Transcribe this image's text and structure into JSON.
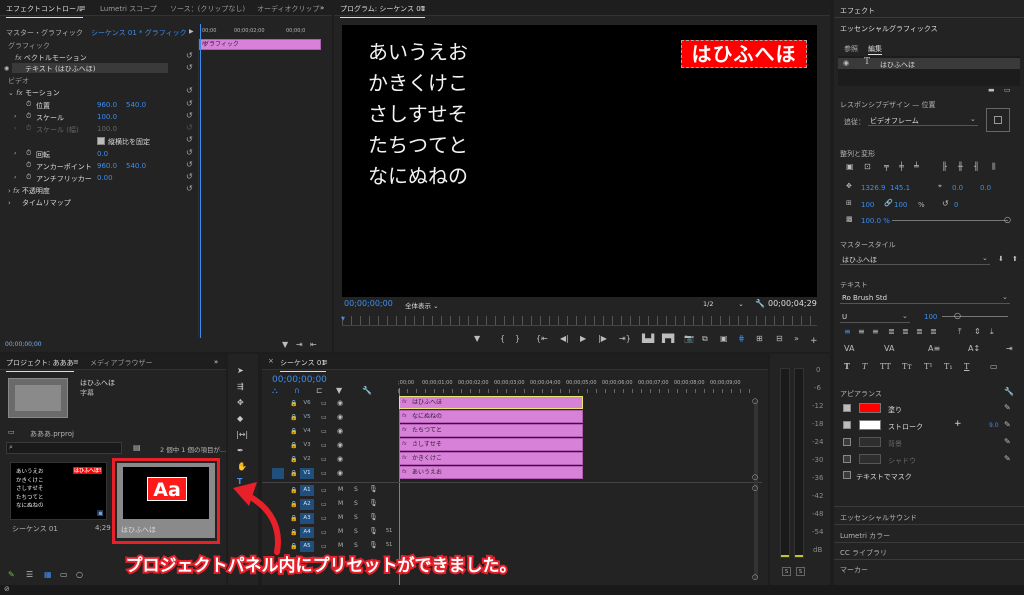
{
  "effect_controls": {
    "tab_label": "エフェクトコントロール",
    "tab_menu": "≡",
    "tab_lumetri": "Lumetri スコープ",
    "tab_source": "ソース：(クリップなし)",
    "tab_audio": "オーディオクリップ",
    "overflow": "»",
    "master": "マスター・グラフィック",
    "sequence": "シーケンス 01 * グラフィック",
    "ruler": [
      "00;00",
      "00;00;02;00",
      "00;00;0"
    ],
    "clip_label": "グラフィック",
    "section_graphic": "グラフィック",
    "vector_motion": "ベクトルモーション",
    "text_layer": "テキスト (はひふへほ)",
    "section_video": "ビデオ",
    "motion": "モーション",
    "position_label": "位置",
    "position_x": "960.0",
    "position_y": "540.0",
    "scale_label": "スケール",
    "scale_value": "100.0",
    "scale_w_label": "スケール (幅)",
    "scale_w_value": "100.0",
    "uniform_scale": "縦横比を固定",
    "rotation_label": "回転",
    "rotation_value": "0.0",
    "anchor_label": "アンカーポイント",
    "anchor_x": "960.0",
    "anchor_y": "540.0",
    "flicker_label": "アンチフリッカー",
    "flicker_value": "0.00",
    "opacity": "不透明度",
    "time_remap": "タイムリマップ",
    "timecode": "00;00;00;00"
  },
  "program": {
    "tab_label": "プログラム: シーケンス 01",
    "tab_menu": "≡",
    "lines": [
      "あいうえお",
      "かきくけこ",
      "さしすせそ",
      "たちつてと",
      "なにぬねの"
    ],
    "title_text": "はひふへほ",
    "timecode": "00;00;00;00",
    "zoom": "全体表示",
    "resolution": "1/2",
    "duration": "00;00;04;29"
  },
  "project": {
    "tab_label": "プロジェクト: あああ",
    "tab_menu": "≡",
    "tab_browser": "メディアブラウザー",
    "overflow": "»",
    "preview_name": "はひふへほ",
    "preview_sub": "字幕",
    "file_name": "あああ.prproj",
    "selection": "2 個中 1 個の項目が...",
    "item1_name": "シーケンス 01",
    "item1_duration": "4;29",
    "item2_name": "はひふへほ",
    "thumb_lines": [
      "あいうえお",
      "かきくけこ",
      "さしすせそ",
      "たちつてと",
      "なにぬねの"
    ],
    "thumb_title": "はひふへほ!",
    "aa_label": "Aa"
  },
  "timeline": {
    "tab_label": "シーケンス 01",
    "tab_menu": "≡",
    "timecode": "00;00;00;00",
    "ruler": [
      ";00;00",
      "00;00;01;00",
      "00;00;02;00",
      "00;00;03;00",
      "00;00;04;00",
      "00;00;05;00",
      "00;00;06;00",
      "00;00;07;00",
      "00;00;08;00",
      "00;00;09;00"
    ],
    "video_tracks": [
      "V6",
      "V5",
      "V4",
      "V3",
      "V2",
      "V1"
    ],
    "audio_tracks": [
      "A1",
      "A2",
      "A3",
      "A4",
      "A5"
    ],
    "clips": [
      "はひふへほ",
      "なにぬねの",
      "たちつてと",
      "さしすせそ",
      "かきくけこ",
      "あいうえお"
    ],
    "audio_m": "M",
    "audio_s": "S",
    "meter_ticks": [
      "0",
      "-6",
      "-12",
      "-18",
      "-24",
      "-30",
      "-36",
      "-42",
      "-48",
      "-54",
      "dB"
    ],
    "meter_s": "S",
    "level1": "51",
    "level2": "51"
  },
  "essential": {
    "tab_effects": "エフェクト",
    "title": "エッセンシャルグラフィックス",
    "tab_browse": "参照",
    "tab_edit": "編集",
    "layer_name": "はひふへほ",
    "responsive": "レスポンシブデザイン — 位置",
    "follow_label": "追従：",
    "follow_value": "ビデオフレーム",
    "align_transform": "整列と変形",
    "pos_x": "1326.9",
    "pos_y": "145.1",
    "anchor_x": "0.0",
    "anchor_y": "0.0",
    "scale_w": "100",
    "scale_h": "100",
    "scale_unit": "%",
    "rotation": "0",
    "opacity": "100.0 %",
    "master_style": "マスタースタイル",
    "master_style_value": "はひふへほ",
    "text_section": "テキスト",
    "font": "Ro Brush Std",
    "font_style": "U",
    "font_size": "100",
    "appearance": "アピアランス",
    "fill": "塗り",
    "fill_color": "#ff0000",
    "stroke": "ストローク",
    "stroke_color": "#ffffff",
    "stroke_width": "9.0",
    "background": "背景",
    "shadow": "シャドウ",
    "mask": "テキストでマスク",
    "essential_sound": "エッセンシャルサウンド",
    "lumetri_color": "Lumetri カラー",
    "cc_library": "CC ライブラリ",
    "markers": "マーカー"
  },
  "annotation": {
    "caption": "プロジェクトパネル内にプリセットができました。",
    "highlight_color": "#e8202a"
  }
}
